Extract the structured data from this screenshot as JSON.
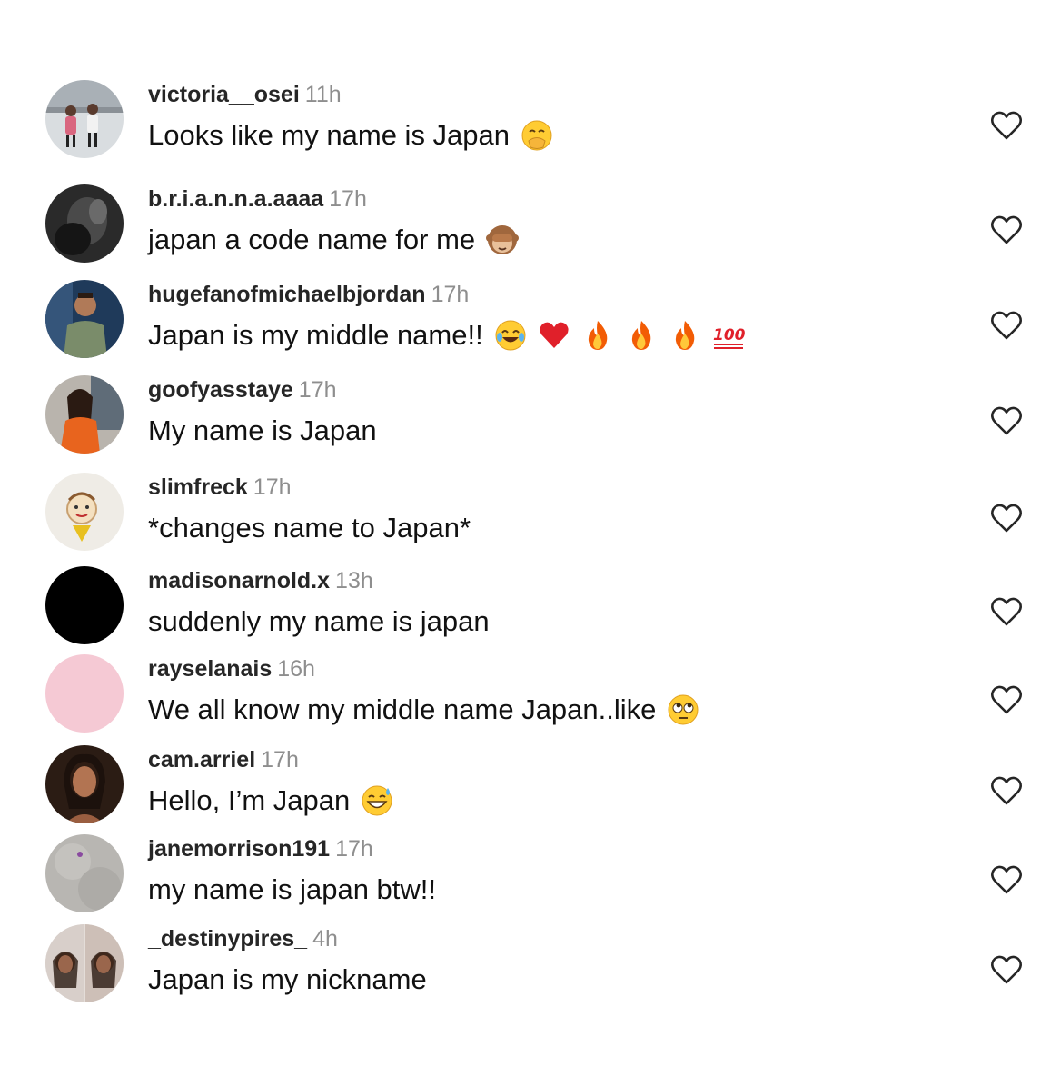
{
  "comments": [
    {
      "username": "victoria__osei",
      "time": "11h",
      "text": "Looks like my name is Japan",
      "avatar": "rink",
      "emojis": [
        "hand-over-mouth-emoji"
      ]
    },
    {
      "username": "b.r.i.a.n.n.a.aaaa",
      "time": "17h",
      "text": "japan a code name for me",
      "avatar": "dark",
      "emojis": [
        "see-no-evil-monkey-emoji"
      ]
    },
    {
      "username": "hugefanofmichaelbjordan",
      "time": "17h",
      "text": "Japan is my middle name!!",
      "avatar": "man",
      "emojis": [
        "tears-of-joy-emoji",
        "red-heart-emoji",
        "fire-emoji",
        "fire-emoji",
        "fire-emoji",
        "hundred-points-emoji"
      ]
    },
    {
      "username": "goofyasstaye",
      "time": "17h",
      "text": "My name is Japan",
      "avatar": "woman-orange",
      "emojis": []
    },
    {
      "username": "slimfreck",
      "time": "17h",
      "text": "*changes name to Japan*",
      "avatar": "drawing",
      "emojis": []
    },
    {
      "username": "madisonarnold.x",
      "time": "13h",
      "text": "suddenly my name is japan",
      "avatar": "black",
      "emojis": []
    },
    {
      "username": "rayselanais",
      "time": "16h",
      "text": "We all know my middle name Japan..like",
      "avatar": "pink",
      "emojis": [
        "eye-roll-emoji"
      ]
    },
    {
      "username": "cam.arriel",
      "time": "17h",
      "text": "Hello, I’m Japan",
      "avatar": "woman-dark",
      "emojis": [
        "grinning-sweat-emoji"
      ]
    },
    {
      "username": "janemorrison191",
      "time": "17h",
      "text": "my name is japan btw!!",
      "avatar": "gray",
      "emojis": []
    },
    {
      "username": "_destinypires_",
      "time": "4h",
      "text": "Japan is my nickname",
      "avatar": "collage",
      "emojis": []
    }
  ],
  "colors": {
    "username": "#262626",
    "timestamp": "#8e8e8e",
    "text": "#111111",
    "like_icon": "#262626"
  },
  "like_icon": "heart-outline-icon"
}
